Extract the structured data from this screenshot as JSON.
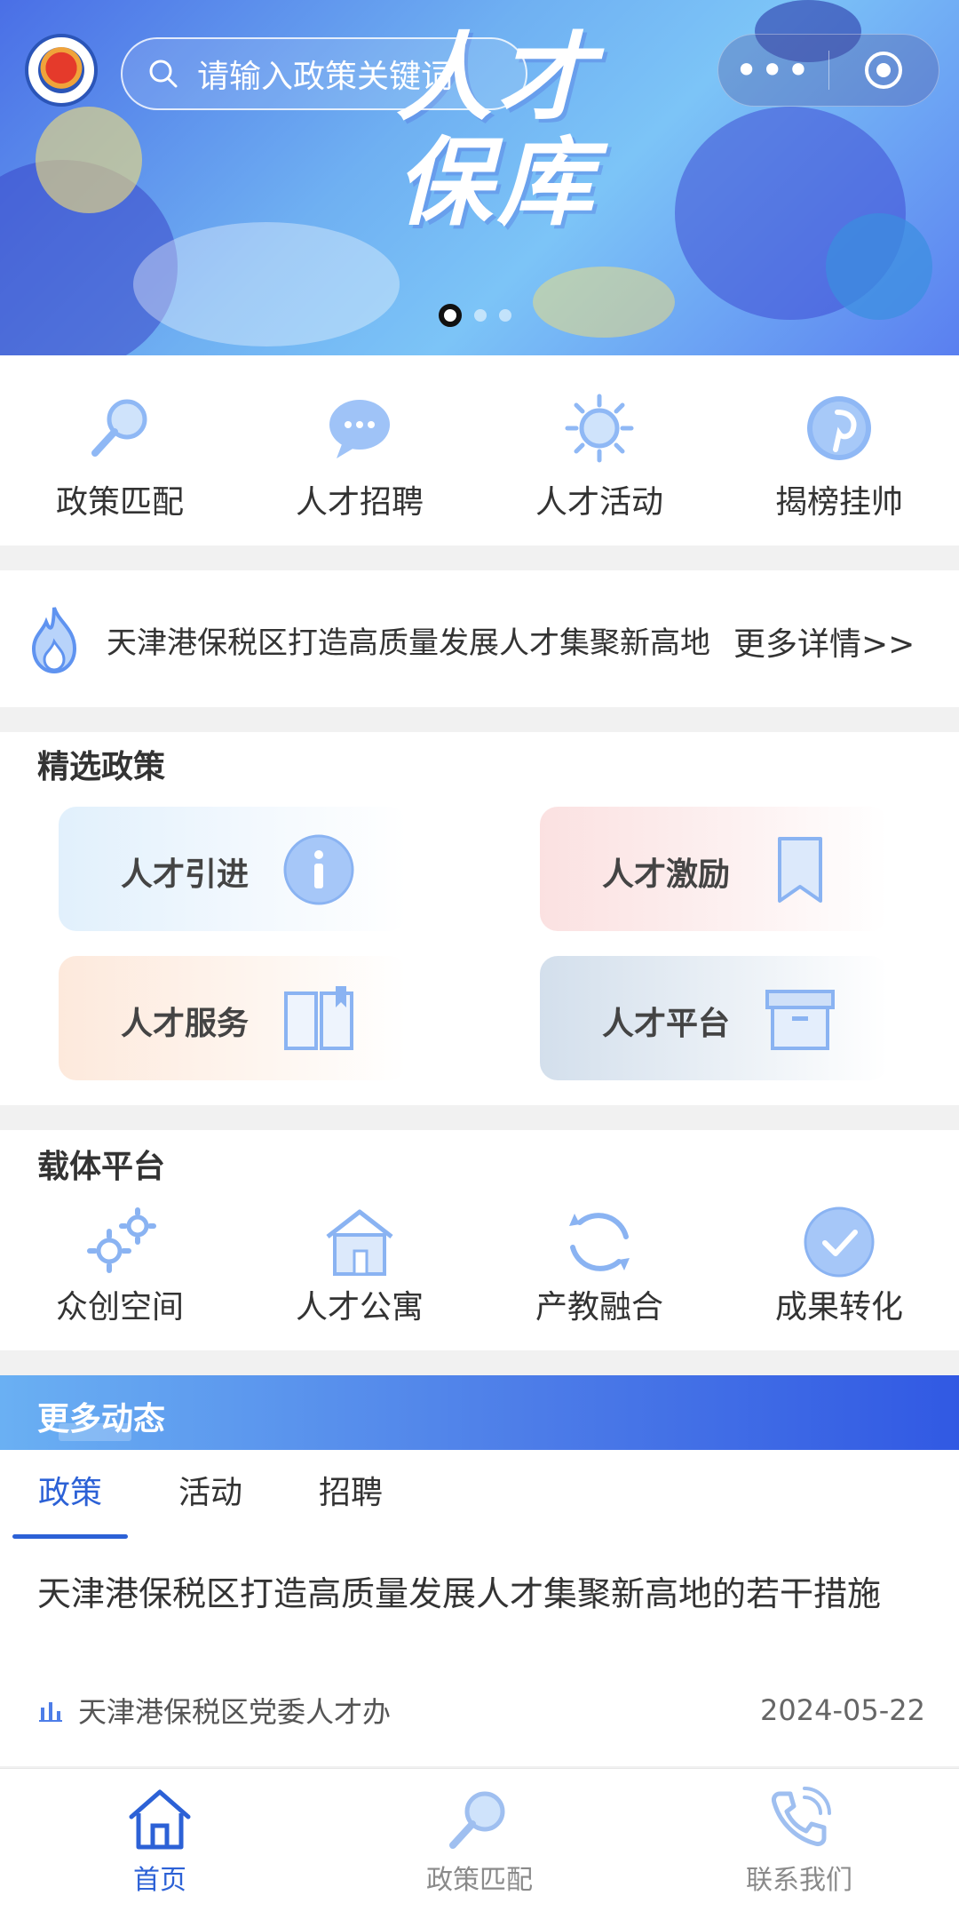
{
  "banner": {
    "title_line1": "人才",
    "title_line2": "保库",
    "search_placeholder": "请输入政策关键词",
    "capsule_more": "•••",
    "pager_count": 3,
    "pager_active": 1
  },
  "quick_nav": [
    {
      "label": "政策匹配",
      "icon": "magnifier-icon"
    },
    {
      "label": "人才招聘",
      "icon": "chat-bubble-icon"
    },
    {
      "label": "人才活动",
      "icon": "sun-icon"
    },
    {
      "label": "揭榜挂帅",
      "icon": "pinterest-icon"
    }
  ],
  "notice": {
    "text": "天津港保税区打造高质量发展人才集聚新高地",
    "more": "更多详情>>"
  },
  "policy_section": {
    "title": "精选政策",
    "cards": [
      {
        "label": "人才引进",
        "icon": "info-icon"
      },
      {
        "label": "人才激励",
        "icon": "bookmark-icon"
      },
      {
        "label": "人才服务",
        "icon": "book-icon"
      },
      {
        "label": "人才平台",
        "icon": "archive-box-icon"
      }
    ]
  },
  "carrier_section": {
    "title": "载体平台",
    "items": [
      {
        "label": "众创空间",
        "icon": "gears-icon"
      },
      {
        "label": "人才公寓",
        "icon": "house-icon"
      },
      {
        "label": "产教融合",
        "icon": "refresh-circle-icon"
      },
      {
        "label": "成果转化",
        "icon": "check-circle-icon"
      }
    ]
  },
  "dynamics": {
    "title": "更多动态",
    "tabs": [
      "政策",
      "活动",
      "招聘"
    ],
    "active_tab": 0,
    "news": {
      "title": "天津港保税区打造高质量发展人才集聚新高地的若干措施",
      "source": "天津港保税区党委人才办",
      "date": "2024-05-22"
    }
  },
  "tabbar": [
    {
      "label": "首页",
      "icon": "home-icon",
      "active": true
    },
    {
      "label": "政策匹配",
      "icon": "magnifier-icon",
      "active": false
    },
    {
      "label": "联系我们",
      "icon": "phone-icon",
      "active": false
    }
  ],
  "colors": {
    "accent": "#2c61d6",
    "icon_blue": "#8fb8f5",
    "banner_start": "#4a6fe6",
    "banner_end": "#5a7ff0"
  }
}
